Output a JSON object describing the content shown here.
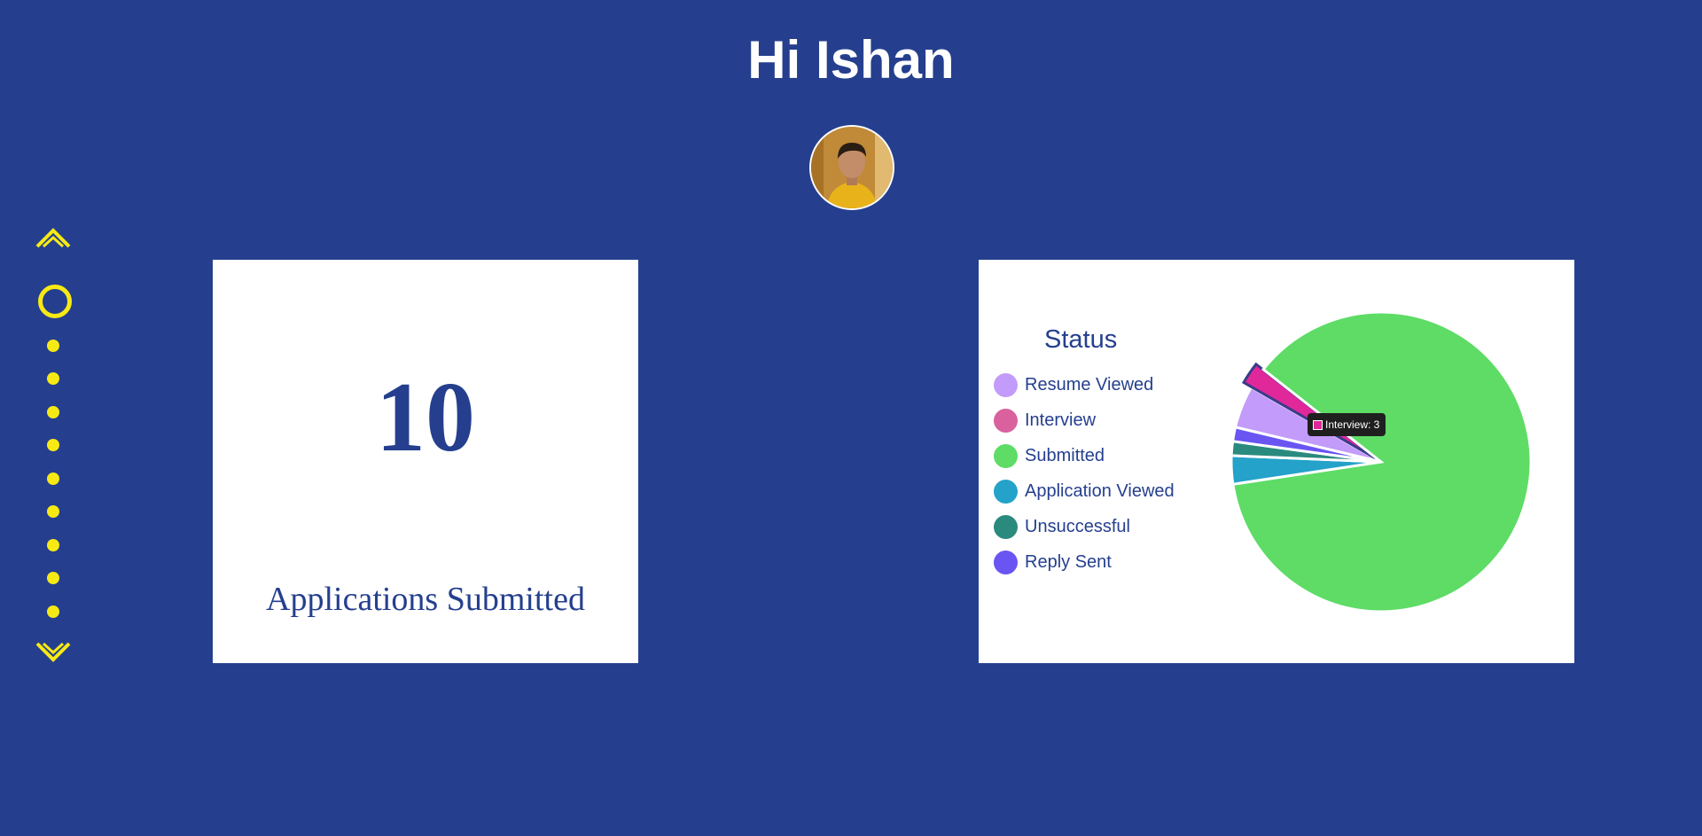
{
  "header": {
    "greeting": "Hi Ishan"
  },
  "avatar": {
    "description_icon": "profile-photo"
  },
  "scroll_nav": {
    "up_icon": "chevron-up-icon",
    "down_icon": "chevron-down-icon",
    "dot_count": 9,
    "accent_color": "#f7ea14"
  },
  "summary_card": {
    "value": "10",
    "label": "Applications Submitted"
  },
  "status_card": {
    "legend_title": "Status",
    "tooltip": {
      "text": "Interview: 3",
      "color": "#e0289b"
    }
  },
  "colors": {
    "background": "#253f8e",
    "card": "#ffffff",
    "text_primary": "#253f8e"
  },
  "chart_data": {
    "type": "pie",
    "title": "Status",
    "legend_placement": "left",
    "categories": [
      "Resume Viewed",
      "Interview",
      "Submitted",
      "Application Viewed",
      "Unsuccessful",
      "Reply Sent"
    ],
    "values": [
      6,
      3,
      114,
      4,
      2,
      2
    ],
    "colors": [
      "#c39bfa",
      "#d9619e",
      "#5edc66",
      "#24a2c9",
      "#2a8a7e",
      "#6a55f2"
    ],
    "highlighted": "Interview"
  }
}
